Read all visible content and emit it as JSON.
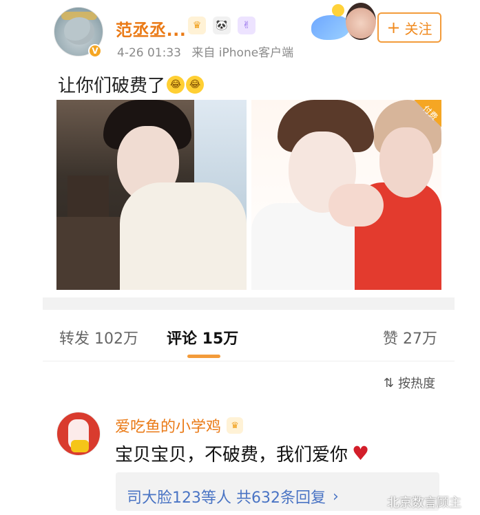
{
  "post": {
    "username": "范丞丞...",
    "time": "4-26 01:33",
    "source": "来自 iPhone客户端",
    "follow_label": "关注",
    "text": "让你们破费了",
    "paid_tag": "付费",
    "badges": [
      "crown-icon",
      "panda-icon",
      "peace-hand-icon"
    ]
  },
  "stats": {
    "repost_label": "转发 102万",
    "comment_label": "评论 15万",
    "like_label": "赞 27万"
  },
  "sort_label": "按热度",
  "comment": {
    "name": "爱吃鱼的小学鸡",
    "text": "宝贝宝贝，不破费，我们爱你",
    "replies_label": "司大脸123等人  共632条回复",
    "replies_chevron": "›"
  },
  "watermark": "北京数言顾主",
  "colors": {
    "accent": "#ea7a16",
    "follow_border": "#f39b3a",
    "link_blue": "#4a74c4",
    "heart": "#d31e2a",
    "red_avatar": "#d93b2e"
  }
}
